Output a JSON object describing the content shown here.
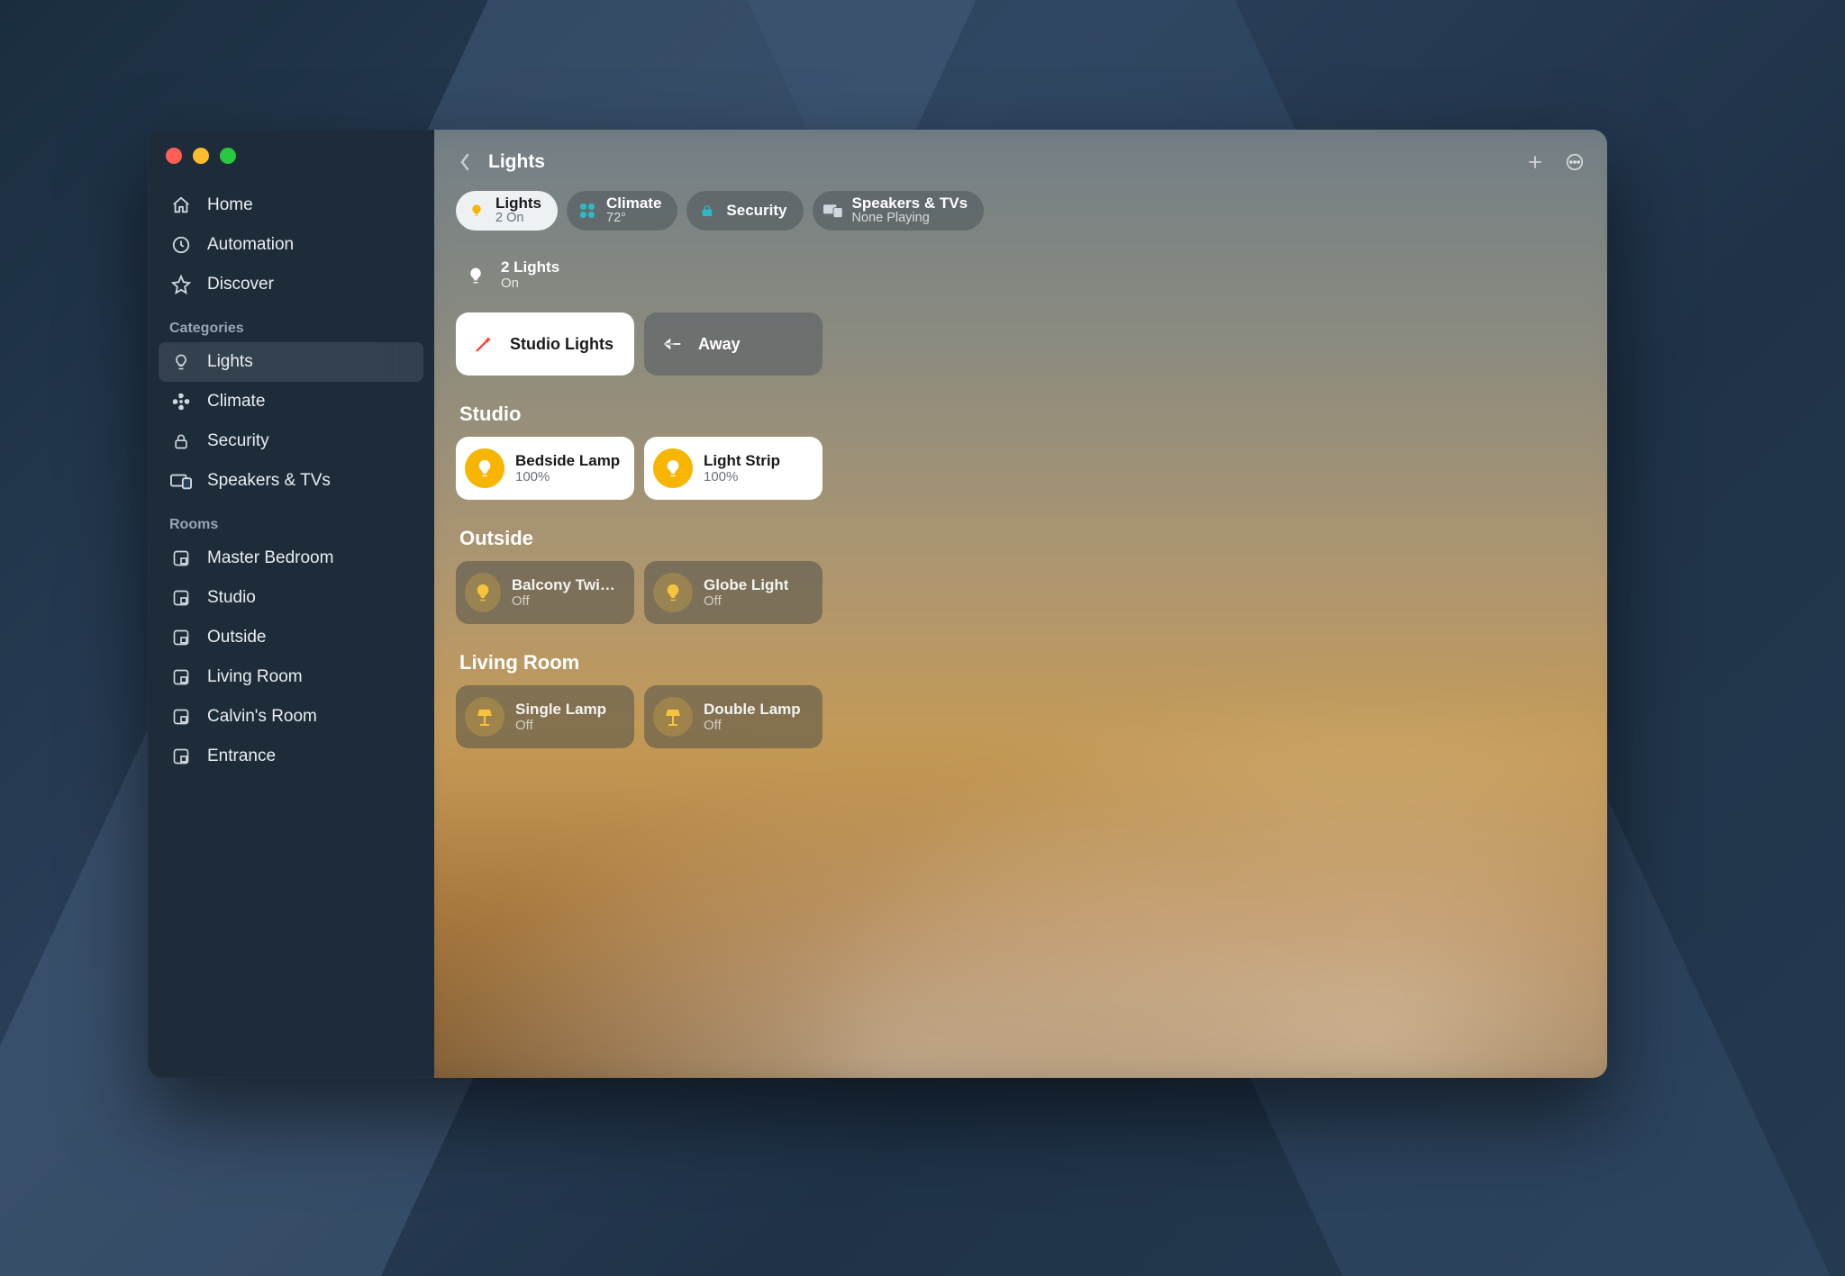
{
  "window": {
    "title": "Lights"
  },
  "sidebar": {
    "nav": [
      {
        "id": "home",
        "label": "Home",
        "icon": "house"
      },
      {
        "id": "automation",
        "label": "Automation",
        "icon": "clock"
      },
      {
        "id": "discover",
        "label": "Discover",
        "icon": "star"
      }
    ],
    "categories_label": "Categories",
    "categories": [
      {
        "id": "lights",
        "label": "Lights",
        "icon": "bulb",
        "active": true
      },
      {
        "id": "climate",
        "label": "Climate",
        "icon": "fan",
        "active": false
      },
      {
        "id": "security",
        "label": "Security",
        "icon": "lock",
        "active": false
      },
      {
        "id": "speakers",
        "label": "Speakers & TVs",
        "icon": "tv",
        "active": false
      }
    ],
    "rooms_label": "Rooms",
    "rooms": [
      {
        "id": "master",
        "label": "Master Bedroom"
      },
      {
        "id": "studio",
        "label": "Studio"
      },
      {
        "id": "outside",
        "label": "Outside"
      },
      {
        "id": "living",
        "label": "Living Room"
      },
      {
        "id": "calvin",
        "label": "Calvin's Room"
      },
      {
        "id": "entrance",
        "label": "Entrance"
      }
    ]
  },
  "header_pills": [
    {
      "id": "lights",
      "title": "Lights",
      "subtitle": "2 On",
      "icon": "bulb",
      "color": "#f7b500",
      "active": true
    },
    {
      "id": "climate",
      "title": "Climate",
      "subtitle": "72°",
      "icon": "climate",
      "color": "#2fb8c5",
      "active": false
    },
    {
      "id": "security",
      "title": "Security",
      "subtitle": "",
      "icon": "lock",
      "color": "#2fb8c5",
      "active": false
    },
    {
      "id": "speakers",
      "title": "Speakers & TVs",
      "subtitle": "None Playing",
      "icon": "tv",
      "color": "#cfd7df",
      "active": false
    }
  ],
  "summary": {
    "title": "2 Lights",
    "subtitle": "On"
  },
  "scenes": [
    {
      "id": "studio-lights",
      "label": "Studio Lights",
      "icon": "wand",
      "active": true,
      "iconColor": "#ff3b30"
    },
    {
      "id": "away",
      "label": "Away",
      "icon": "plane",
      "active": false,
      "iconColor": "#ffffff"
    }
  ],
  "rooms": [
    {
      "name": "Studio",
      "accessories": [
        {
          "name": "Bedside Lamp",
          "status": "100%",
          "on": true,
          "icon": "bulb"
        },
        {
          "name": "Light Strip",
          "status": "100%",
          "on": true,
          "icon": "bulb"
        }
      ]
    },
    {
      "name": "Outside",
      "accessories": [
        {
          "name": "Balcony Twink…",
          "status": "Off",
          "on": false,
          "icon": "bulb"
        },
        {
          "name": "Globe Light",
          "status": "Off",
          "on": false,
          "icon": "bulb"
        }
      ]
    },
    {
      "name": "Living Room",
      "accessories": [
        {
          "name": "Single Lamp",
          "status": "Off",
          "on": false,
          "icon": "lamp"
        },
        {
          "name": "Double Lamp",
          "status": "Off",
          "on": false,
          "icon": "lamp"
        }
      ]
    }
  ]
}
